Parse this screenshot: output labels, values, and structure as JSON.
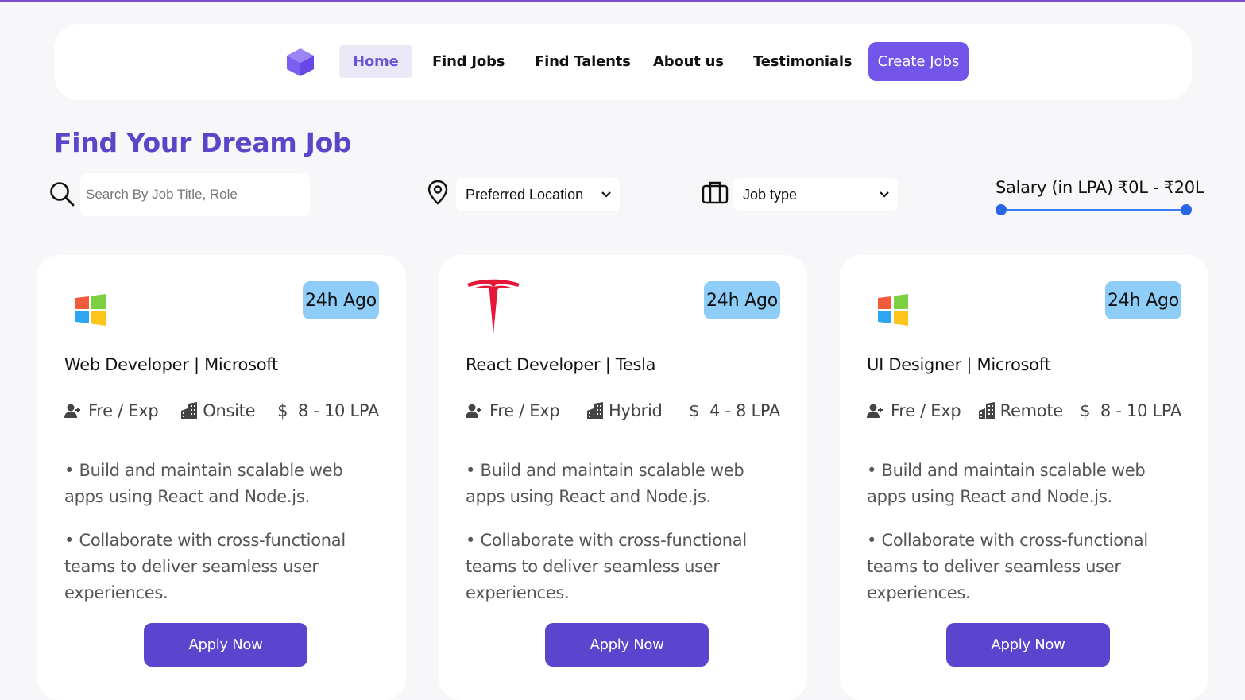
{
  "nav": {
    "items": [
      {
        "label": "Home",
        "active": true
      },
      {
        "label": "Find Jobs",
        "active": false
      },
      {
        "label": "Find Talents",
        "active": false
      },
      {
        "label": "About us",
        "active": false
      },
      {
        "label": "Testimonials",
        "active": false
      }
    ],
    "cta_label": "Create Jobs",
    "logo_icon": "purple-cube-logo"
  },
  "page": {
    "title": "Find Your Dream Job"
  },
  "filters": {
    "search_placeholder": "Search By Job Title, Role",
    "location_label": "Preferred Location",
    "jobtype_label": "Job type",
    "salary_label": "Salary (in LPA) ₹0L - ₹20L",
    "salary_range": {
      "min": 0,
      "max": 20,
      "unit": "LPA"
    }
  },
  "cards": [
    {
      "company_icon": "microsoft-logo",
      "posted": "24h Ago",
      "title": "Web Developer | Microsoft",
      "experience": "Fre / Exp",
      "work_mode": "Onsite",
      "salary": "$  8 - 10 LPA",
      "desc1": "• Build and maintain scalable web apps using React and Node.js.",
      "desc2": "• Collaborate with cross-functional teams to deliver seamless user experiences.",
      "apply_label": "Apply Now"
    },
    {
      "company_icon": "tesla-logo",
      "posted": "24h Ago",
      "title": "React Developer | Tesla",
      "experience": "Fre / Exp",
      "work_mode": "Hybrid",
      "salary": "$  4 - 8 LPA",
      "desc1": "• Build and maintain scalable web apps using React and Node.js.",
      "desc2": "• Collaborate with cross-functional teams to deliver seamless user experiences.",
      "apply_label": "Apply Now"
    },
    {
      "company_icon": "microsoft-logo",
      "posted": "24h Ago",
      "title": "UI Designer | Microsoft",
      "experience": "Fre / Exp",
      "work_mode": "Remote",
      "salary": "$  8 - 10 LPA",
      "desc1": "• Build and maintain scalable web apps using React and Node.js.",
      "desc2": "• Collaborate with cross-functional teams to deliver seamless user experiences.",
      "apply_label": "Apply Now"
    }
  ],
  "colors": {
    "brand": "#5c45c9",
    "cta": "#7455ea",
    "apply": "#5b45cf",
    "badge": "#8ecdf8",
    "slider": "#2966e4"
  }
}
